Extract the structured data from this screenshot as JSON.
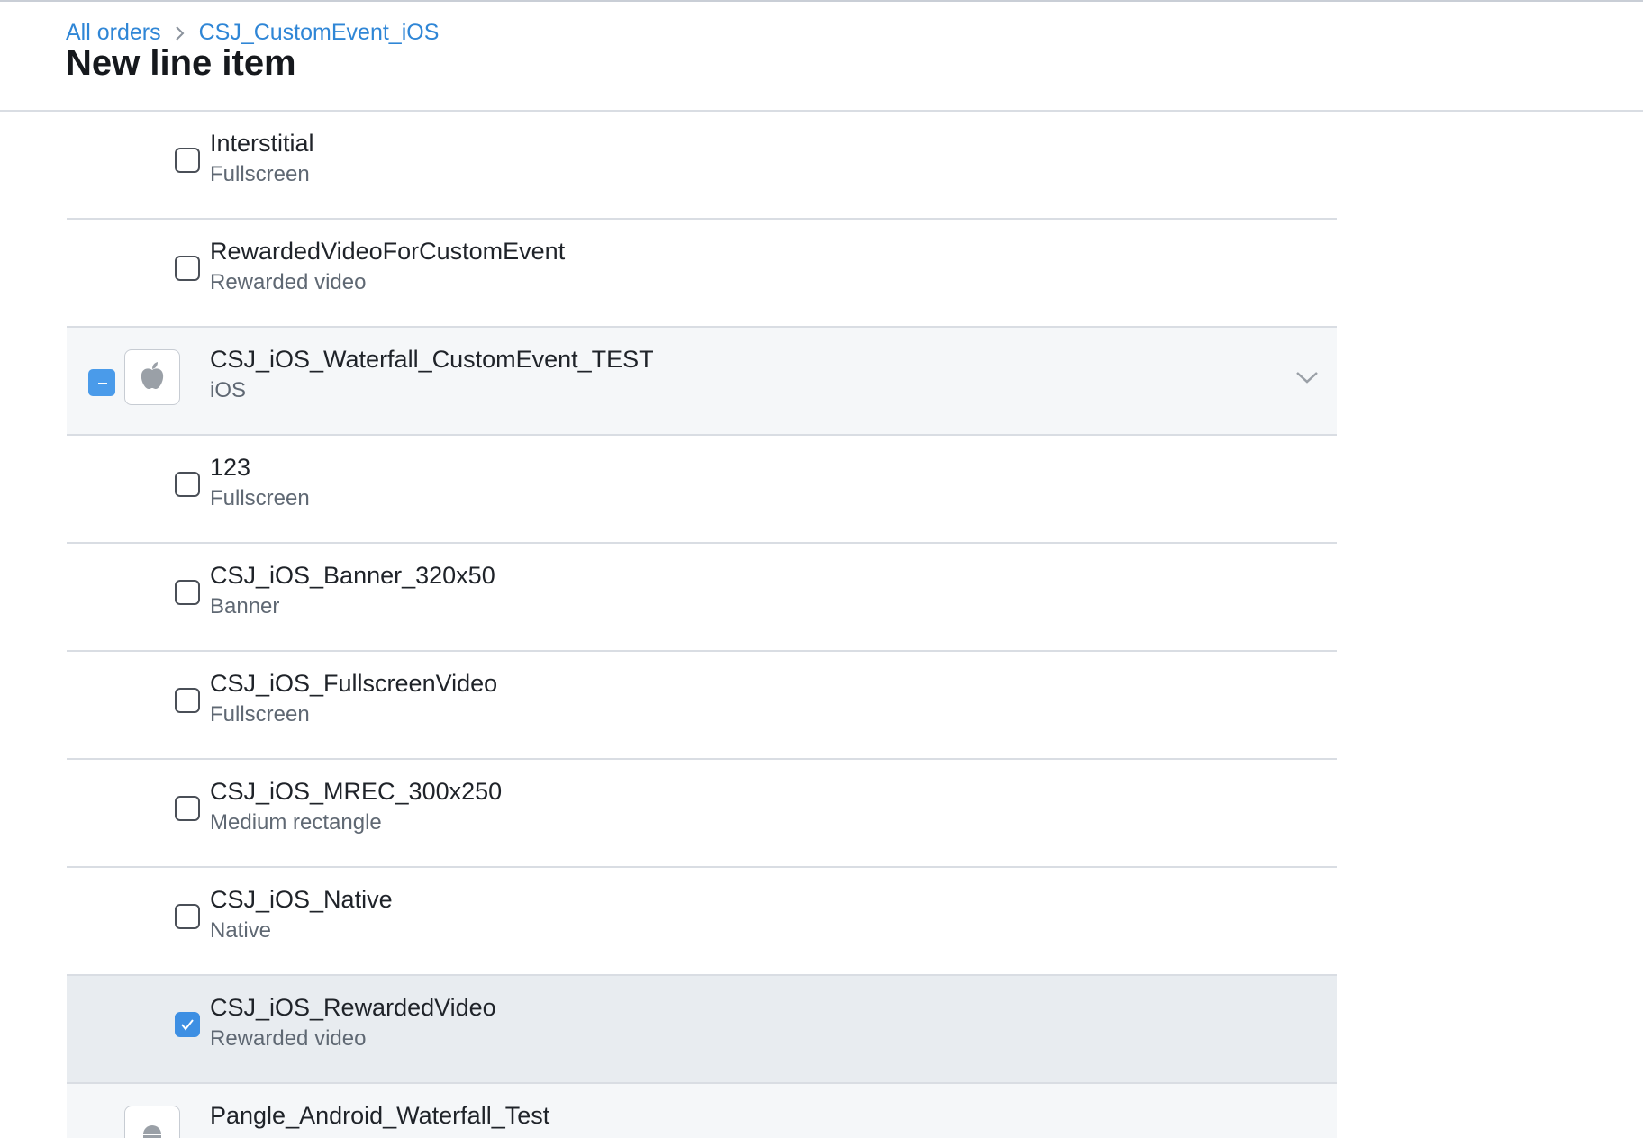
{
  "breadcrumb": {
    "items": [
      "All orders",
      "CSJ_CustomEvent_iOS"
    ]
  },
  "page": {
    "title": "New line item"
  },
  "rows": [
    {
      "kind": "child",
      "title": "Interstitial",
      "subtitle": "Fullscreen",
      "checked": false
    },
    {
      "kind": "child",
      "title": "RewardedVideoForCustomEvent",
      "subtitle": "Rewarded video",
      "checked": false
    },
    {
      "kind": "group",
      "title": "CSJ_iOS_Waterfall_CustomEvent_TEST",
      "subtitle": "iOS",
      "icon": "apple-icon",
      "state": "indeterminate"
    },
    {
      "kind": "child",
      "title": "123",
      "subtitle": "Fullscreen",
      "checked": false
    },
    {
      "kind": "child",
      "title": "CSJ_iOS_Banner_320x50",
      "subtitle": "Banner",
      "checked": false
    },
    {
      "kind": "child",
      "title": "CSJ_iOS_FullscreenVideo",
      "subtitle": "Fullscreen",
      "checked": false
    },
    {
      "kind": "child",
      "title": "CSJ_iOS_MREC_300x250",
      "subtitle": "Medium rectangle",
      "checked": false
    },
    {
      "kind": "child",
      "title": "CSJ_iOS_Native",
      "subtitle": "Native",
      "checked": false
    },
    {
      "kind": "child",
      "title": "CSJ_iOS_RewardedVideo",
      "subtitle": "Rewarded video",
      "checked": true
    },
    {
      "kind": "group",
      "title": "Pangle_Android_Waterfall_Test",
      "icon": "android-icon"
    }
  ],
  "colors": {
    "link": "#2f86d6",
    "accent": "#3d8fe3",
    "selected_row": "#e8ecf0",
    "group_row": "#f5f7f9"
  }
}
